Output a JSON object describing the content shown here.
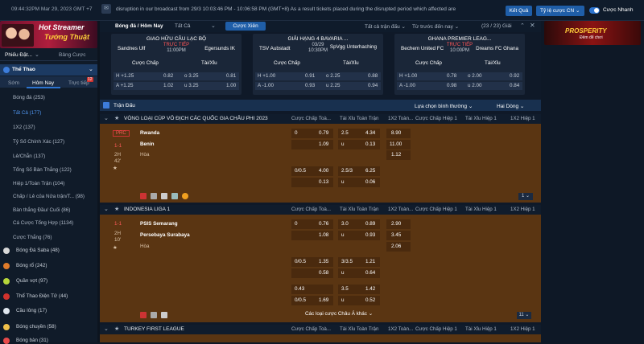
{
  "topbar": {
    "clock": "09:44:32PM Mar 29, 2023 GMT +7",
    "announcement_icon": "megaphone-icon",
    "ticker": "disruption in our broadcast from 29/3 10:03:46 PM - 10:06:58 PM (GMT+8) As a result tickets placed during the disrupted period which affected are",
    "result_btn": "Kết Quả",
    "odds_format": "Tỷ lệ cược CN",
    "odds_format_chev": "⌄",
    "quick_bet": "Cược Nhanh"
  },
  "left": {
    "banner_line1": "Hot Streamer",
    "banner_line2": "Tướng Thuật",
    "tab_detail": "Phiếu Đặt...",
    "tab_detail_chev": "⌄",
    "tab_bets": "Bảng Cược",
    "sport_head": "Thể Thao",
    "sport_head_chev": "⌄",
    "subtabs": {
      "early": "Sớm",
      "today": "Hôm Nay",
      "live": "Trực tiếp",
      "live_badge": "12"
    },
    "items": [
      "Bóng đá (253)",
      "Tất Cả (177)",
      "1X2 (137)",
      "Tỷ Số Chính Xác (127)",
      "Lẻ/Chẵn (137)",
      "Tổng Số Bàn Thắng (122)",
      "Hiệp 1/Toàn Trận (104)",
      "Chấp / Lẻ của Nửa trận/T... (98)",
      "Bàn thắng Đầu/ Cuối (86)",
      "Cá Cược Tổng Hợp (1134)",
      "Cược Thắng (76)"
    ],
    "sports": [
      "Bóng Đá Saba (48)",
      "Bóng rổ (242)",
      "Quần vợt (97)",
      "Thể Thao Điện Tử (44)",
      "Cầu lông (17)",
      "Bóng chuyền (58)",
      "Bóng bàn (31)"
    ]
  },
  "main": {
    "breadcrumb": "Bóng đá / Hôm Nay",
    "filter_all": "Tất Cả",
    "filter_chev": "⌄",
    "view_bets_btn": "Cược Xiên",
    "sel_matches": "Tất cả trận đấu ⌄",
    "sel_sort": "Từ trước đến nay ⌄",
    "league_count": "(23 / 23) Giải",
    "close": "✕",
    "cards": [
      {
        "league": "GIAO HỮU CÂU LẠC BỘ",
        "home": "Sandnes Ulf",
        "away": "Egersunds IK",
        "status": "TRỰC TIẾP",
        "time": "11:00PM",
        "h_label": "Cược Chấp",
        "t_label": "Tài/Xỉu",
        "rows": [
          [
            "H +1.25",
            "0.82",
            "o 3.25",
            "0.81"
          ],
          [
            "A +1.25",
            "1.02",
            "u 3.25",
            "1.00"
          ]
        ]
      },
      {
        "league": "GIẢI HẠNG 4 BAVARIA ...",
        "home": "TSV Aubstadt",
        "away": "SpVgg Unterhaching",
        "status": "03/29",
        "time": "10:30PM",
        "h_label": "Cược Chấp",
        "t_label": "Tài/Xỉu",
        "rows": [
          [
            "H +1.00",
            "0.91",
            "o 2.25",
            "0.88"
          ],
          [
            "A -1.00",
            "0.93",
            "u 2.25",
            "0.94"
          ]
        ]
      },
      {
        "league": "GHANA PREMIER LEAG...",
        "home": "Bechem United FC",
        "away": "Dreams FC Ghana",
        "status": "TRỰC TIẾP",
        "time": "10:00PM",
        "h_label": "Cược Chấp",
        "t_label": "Tài/Xỉu",
        "rows": [
          [
            "H +1.00",
            "0.78",
            "o 2.00",
            "0.92"
          ],
          [
            "A -1.00",
            "0.98",
            "u 2.00",
            "0.84"
          ]
        ]
      }
    ],
    "banner_right_line1": "PROSPERITY",
    "banner_right_line2": "Đêm để chơi",
    "grid_title": "Trận Đấu",
    "grid_filter": "Lựa chọn bình thường ⌄",
    "grid_view": "Hai Dòng ⌄",
    "col_headers": [
      "Cược Chấp Toà...",
      "Tài Xỉu Toàn Trận",
      "1X2 Toàn...",
      "Cược Chấp Hiệp 1",
      "Tài Xỉu Hiệp 1",
      "1X2 Hiệp 1"
    ],
    "leagues": [
      {
        "name": "VÒNG LOẠI CÚP VÔ ĐỊCH CÁC QUỐC GIA CHÂU PHI 2023",
        "star": "★",
        "chev": "⌄",
        "prc": "PRC",
        "score": "1-1",
        "period": "2H",
        "minute": "42'",
        "home": "Rwanda",
        "away": "Benin",
        "draw": "Hòa",
        "odds": [
          [
            "0",
            "0.79",
            "2.5",
            "4.34",
            "8.90"
          ],
          [
            "",
            "1.09",
            "u",
            "0.13",
            "11.00"
          ],
          [
            "",
            "",
            "",
            "",
            "1.12"
          ],
          [
            "0/0.5",
            "4.00",
            "2.5/3",
            "6.25",
            ""
          ],
          [
            "",
            "0.13",
            "u",
            "0.06",
            ""
          ]
        ],
        "pager": "1 ⌄"
      },
      {
        "name": "INDONESIA LIGA 1",
        "star": "★",
        "chev": "⌄",
        "score": "1-1",
        "period": "2H",
        "minute": "10'",
        "home": "PSIS Semarang",
        "away": "Persebaya Surabaya",
        "draw": "Hòa",
        "odds": [
          [
            "0",
            "0.76",
            "3.0",
            "0.89",
            "2.90"
          ],
          [
            "",
            "1.08",
            "u",
            "0.93",
            "3.45"
          ],
          [
            "",
            "",
            "",
            "",
            "2.06"
          ],
          [
            "0/0.5",
            "1.35",
            "3/3.5",
            "1.21",
            ""
          ],
          [
            "",
            "0.58",
            "u",
            "0.64",
            ""
          ],
          [
            "0.43",
            "",
            "3.5",
            "1.42",
            ""
          ],
          [
            "0/0.5",
            "1.69",
            "u",
            "0.52",
            ""
          ]
        ],
        "more": "Các loại cược Châu Á khác ⌄",
        "pager": "11 ⌄"
      },
      {
        "name": "TURKEY FIRST LEAGUE",
        "star": "★",
        "chev": "⌄"
      }
    ]
  }
}
